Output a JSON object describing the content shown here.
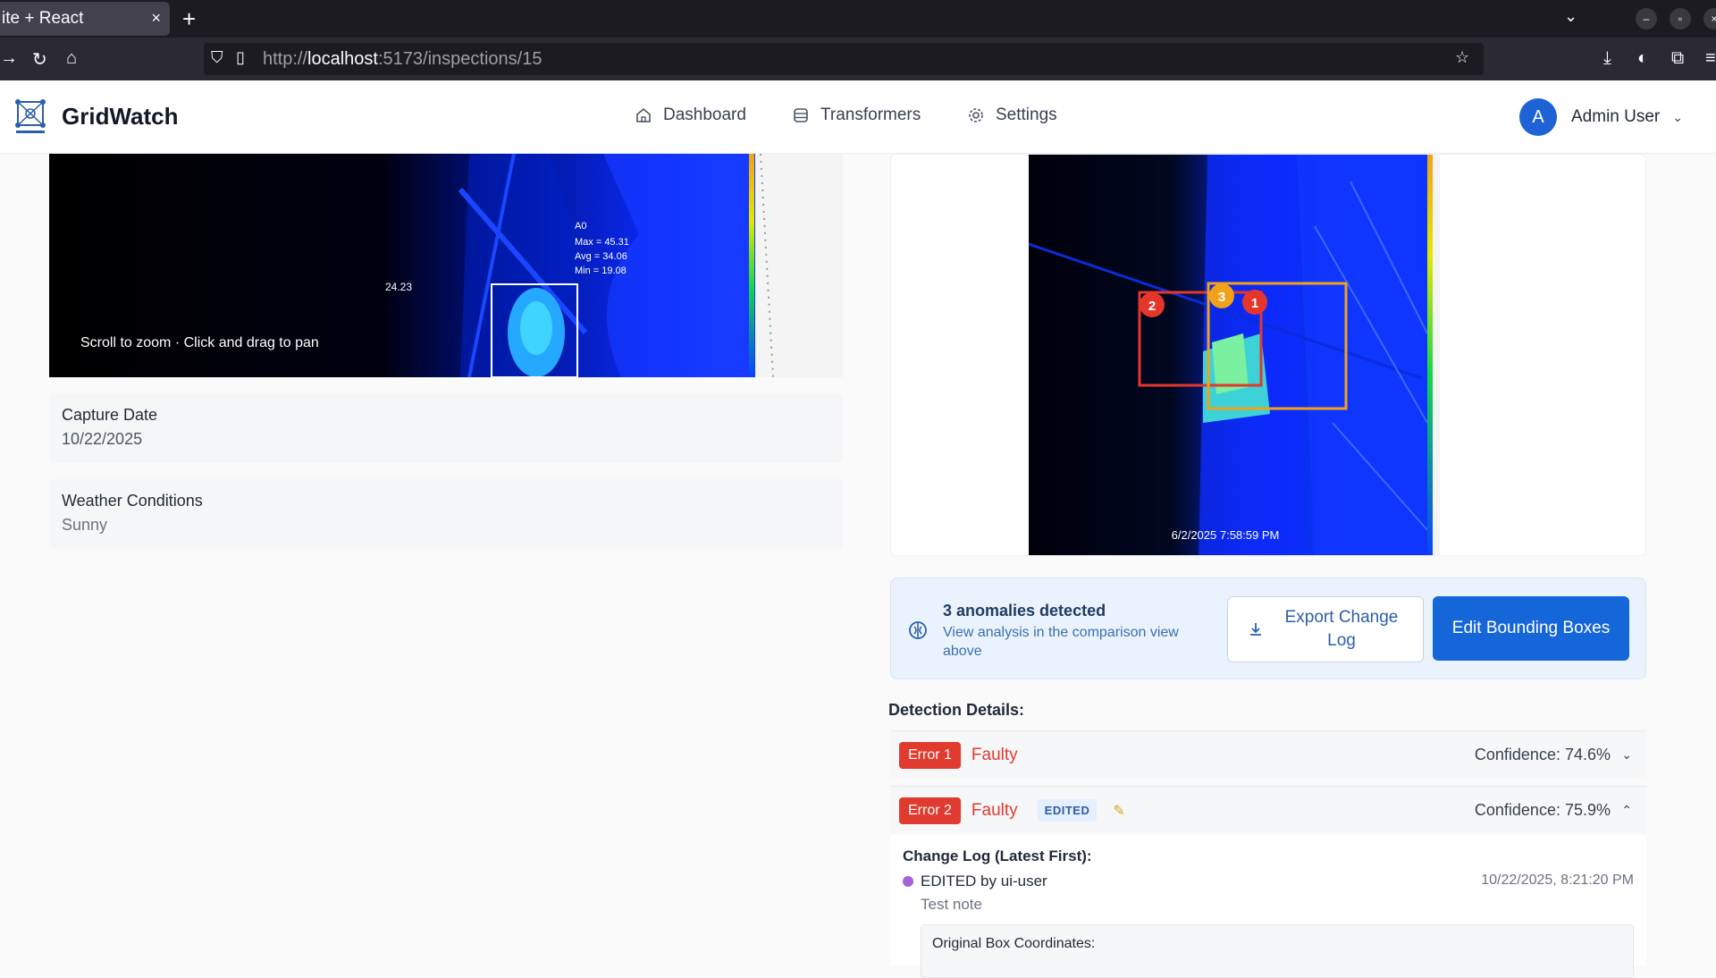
{
  "browser": {
    "tab_title": "ite + React",
    "tab_close": "×",
    "new_tab": "+",
    "url_prefix": "http://",
    "url_host": "localhost",
    "url_path": ":5173/inspections/15"
  },
  "header": {
    "brand": "GridWatch",
    "nav": [
      {
        "label": "Dashboard",
        "icon": "home-icon"
      },
      {
        "label": "Transformers",
        "icon": "database-icon"
      },
      {
        "label": "Settings",
        "icon": "gear-icon"
      }
    ],
    "user": {
      "initial": "A",
      "name": "Admin User"
    }
  },
  "left": {
    "zoom_hint": "Scroll to zoom · Click and drag to pan",
    "thermal_labels": {
      "spot": "24.23",
      "area": "A0",
      "max": "Max = 45.31",
      "avg": "Avg = 34.06",
      "min": "Min = 19.08"
    },
    "capture_date": {
      "label": "Capture Date",
      "value": "10/22/2025"
    },
    "weather": {
      "label": "Weather Conditions",
      "value": "Sunny"
    }
  },
  "right": {
    "timestamp": "6/2/2025 7:58:59 PM",
    "box_numbers": [
      "1",
      "2",
      "3"
    ],
    "colors": {
      "error_box": "#e5362b",
      "warning_box": "#f0a21a"
    }
  },
  "anomaly": {
    "title": "3 anomalies detected",
    "subtitle": "View analysis in the comparison view above",
    "export_label": "Export Change Log",
    "edit_label": "Edit Bounding Boxes"
  },
  "detections": {
    "title": "Detection Details:",
    "rows": [
      {
        "badge": "Error 1",
        "status": "Faulty",
        "confidence": "Confidence: 74.6%",
        "expanded": false
      },
      {
        "badge": "Error 2",
        "status": "Faulty",
        "edited": "EDITED",
        "confidence": "Confidence: 75.9%",
        "expanded": true
      }
    ],
    "change_log": {
      "title": "Change Log (Latest First):",
      "entry": "EDITED by ui-user",
      "time": "10/22/2025, 8:21:20 PM",
      "note": "Test note",
      "box_title": "Original Box Coordinates:"
    }
  }
}
